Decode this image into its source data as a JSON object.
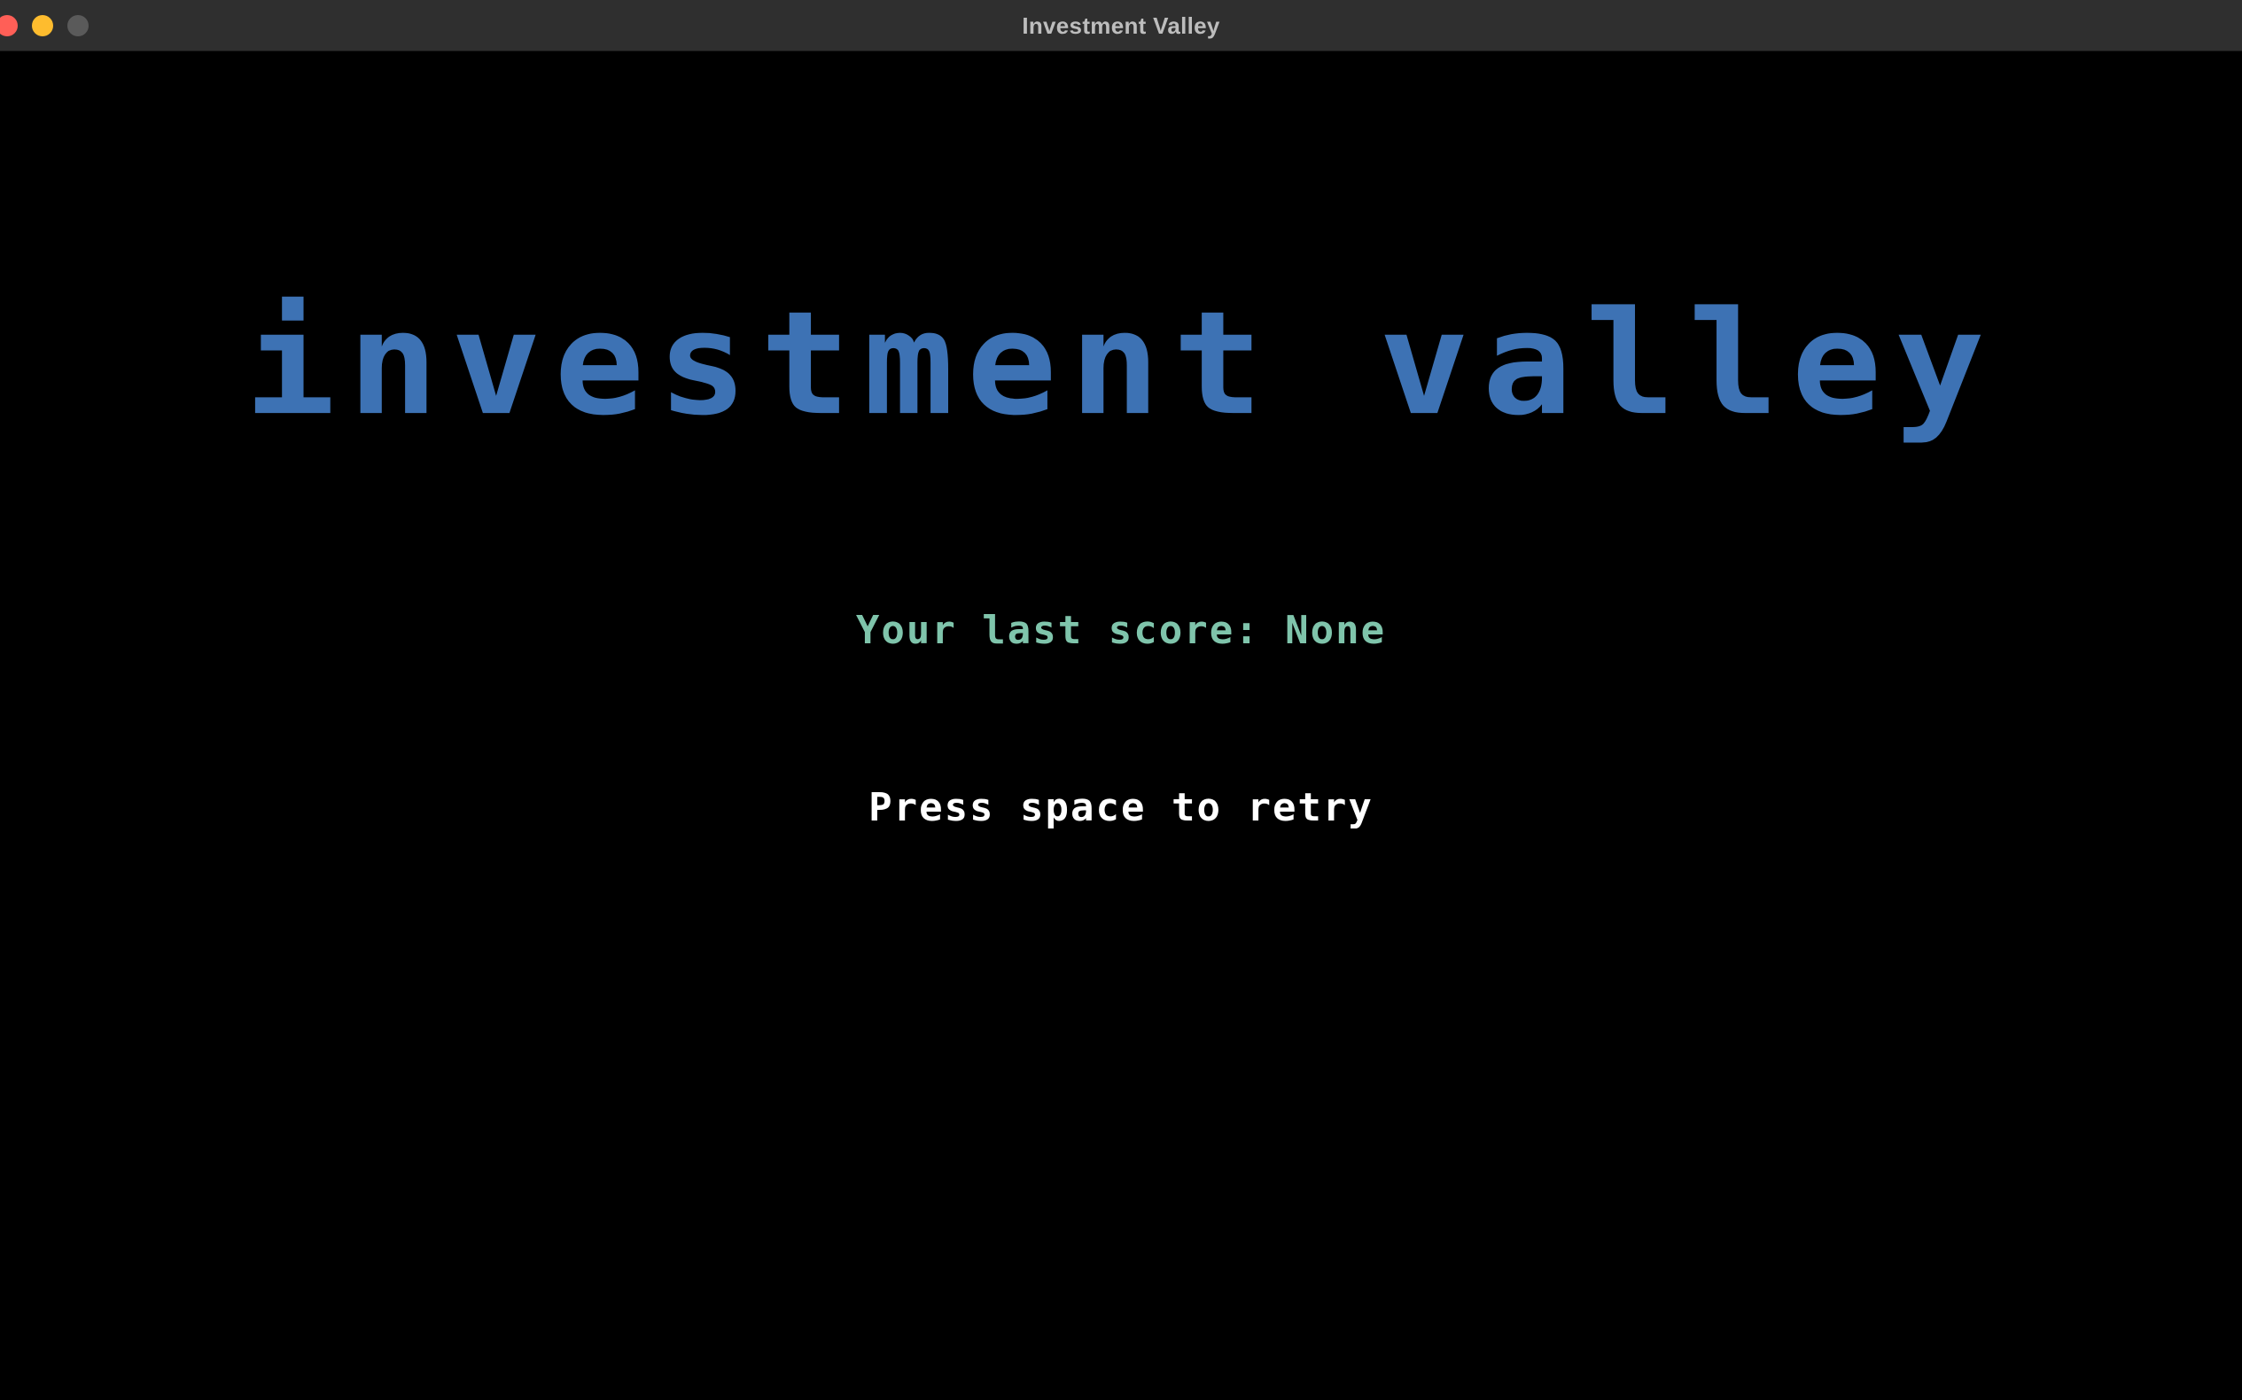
{
  "window": {
    "title": "Investment Valley"
  },
  "game": {
    "title": "Investment Valley",
    "last_score_text": "Your last score: None",
    "prompt_text": "Press space to retry"
  },
  "colors": {
    "title": "#3d72b4",
    "score": "#7fc4ab",
    "prompt": "#ffffff",
    "background": "#000000"
  }
}
